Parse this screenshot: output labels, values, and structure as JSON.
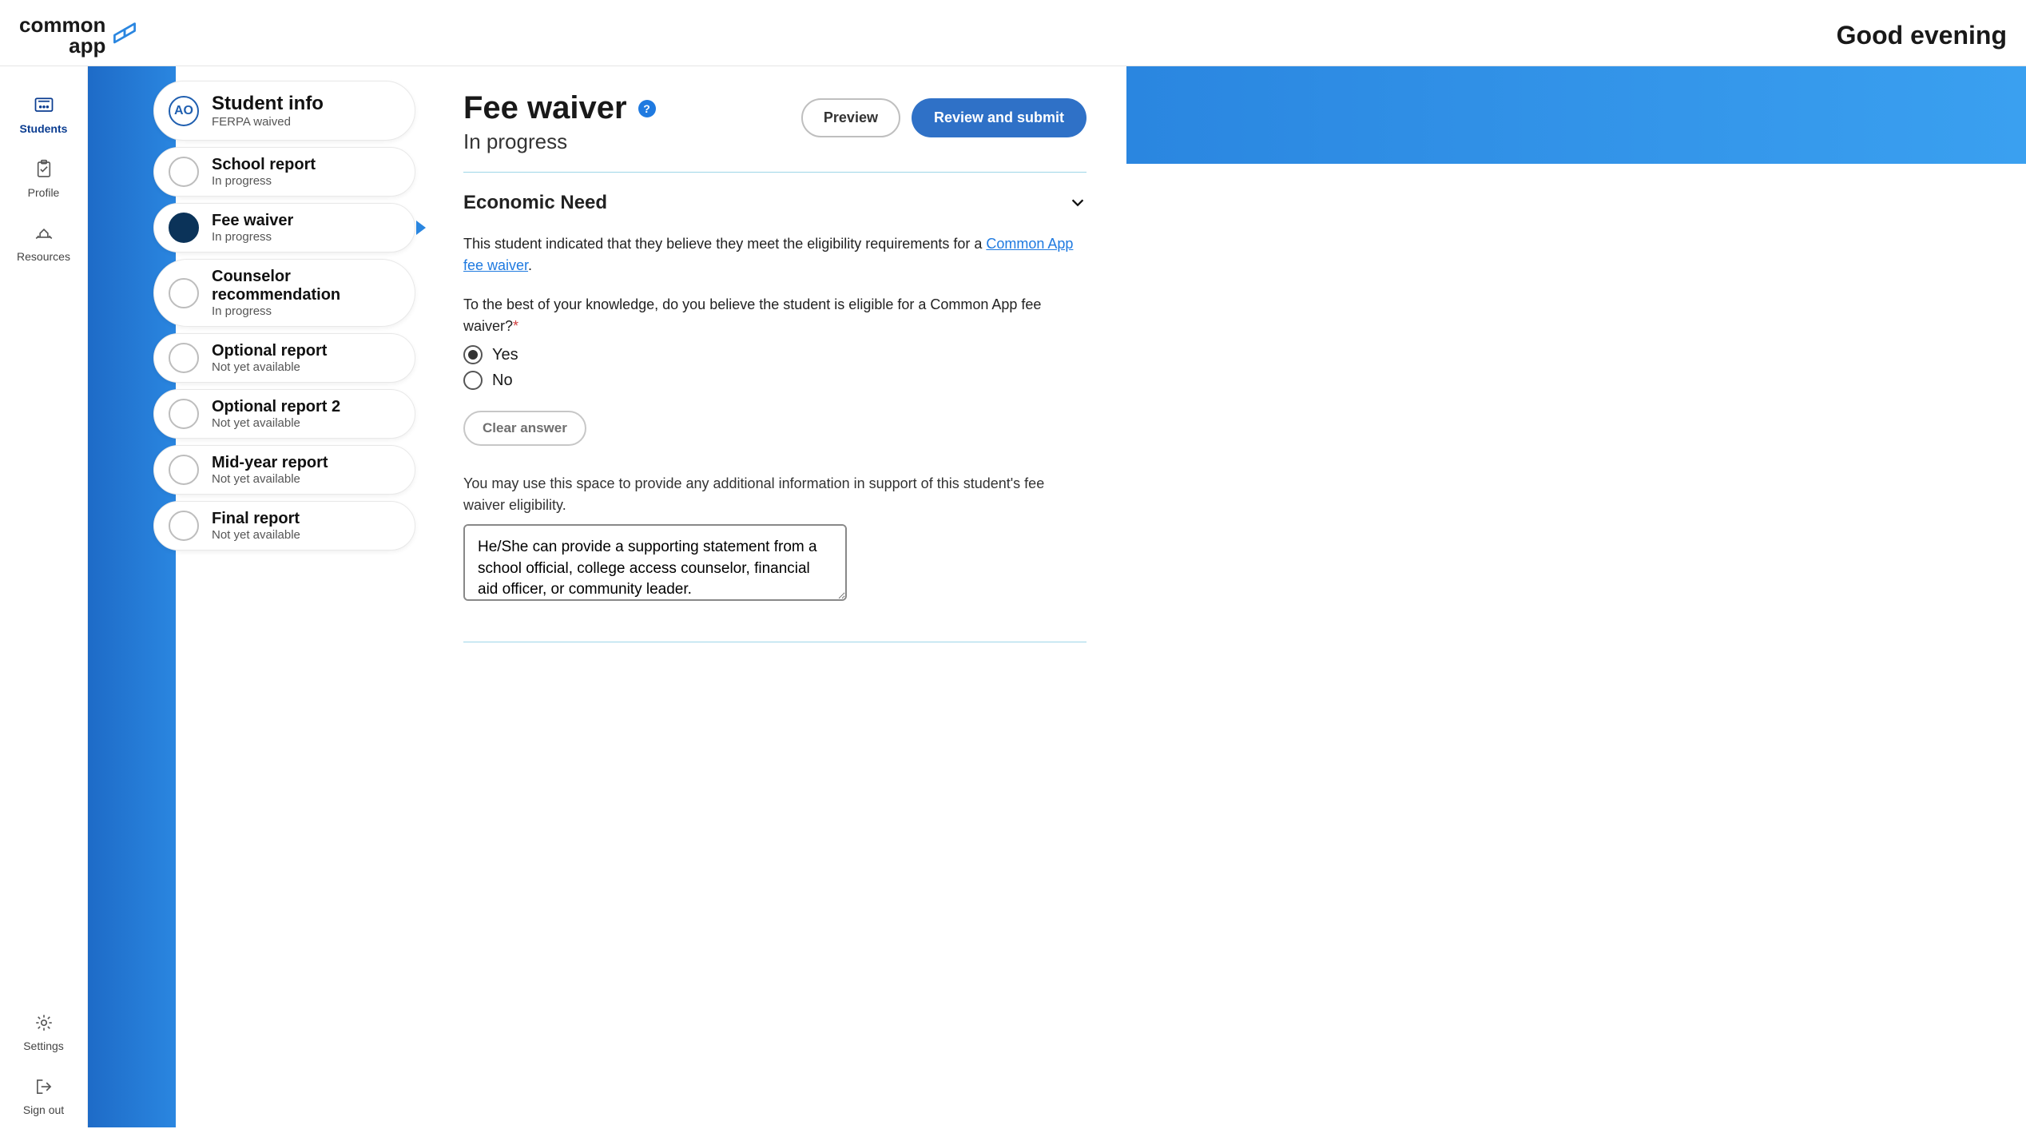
{
  "header": {
    "logo_line1": "common",
    "logo_line2": "app",
    "greeting": "Good evening"
  },
  "rail": {
    "students": "Students",
    "profile": "Profile",
    "resources": "Resources",
    "settings": "Settings",
    "signout": "Sign out"
  },
  "steps": [
    {
      "circle": "AO",
      "title": "Student info",
      "sub": "FERPA waived",
      "kind": "first"
    },
    {
      "title": "School report",
      "sub": "In progress",
      "kind": "empty"
    },
    {
      "title": "Fee waiver",
      "sub": "In progress",
      "kind": "active"
    },
    {
      "title": "Counselor recommendation",
      "sub": "In progress",
      "kind": "empty"
    },
    {
      "title": "Optional report",
      "sub": "Not yet available",
      "kind": "empty"
    },
    {
      "title": "Optional report 2",
      "sub": "Not yet available",
      "kind": "empty"
    },
    {
      "title": "Mid-year report",
      "sub": "Not yet available",
      "kind": "empty"
    },
    {
      "title": "Final report",
      "sub": "Not yet available",
      "kind": "empty"
    }
  ],
  "page": {
    "title": "Fee waiver",
    "subtitle": "In progress",
    "preview": "Preview",
    "review": "Review and submit"
  },
  "section": {
    "title": "Economic Need",
    "lead_prefix": "This student indicated that they believe they meet the eligibility requirements for a ",
    "lead_link": "Common App fee waiver",
    "lead_suffix": ".",
    "question": "To the best of your knowledge, do you believe the student is eligible for a Common App fee waiver?",
    "yes": "Yes",
    "no": "No",
    "clear": "Clear answer",
    "hint": "You may use this space to provide any additional information in support of this student's fee waiver eligibility.",
    "textarea_value": "He/She can provide a supporting statement from a school official, college access counselor, financial aid officer, or community leader."
  }
}
